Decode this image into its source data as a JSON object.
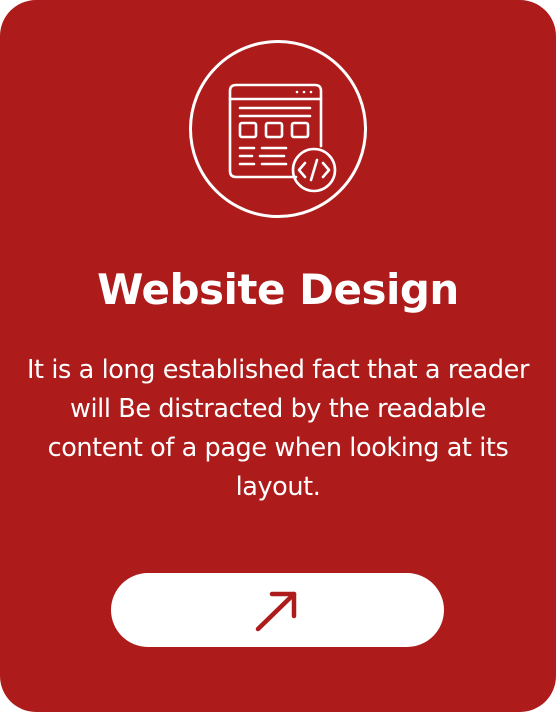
{
  "card": {
    "title": "Website Design",
    "description": "It is a long established fact that a reader will Be distracted by the readable content of a page when looking at its layout.",
    "icon": "web-code-icon",
    "cta_icon": "arrow-up-right-icon"
  },
  "colors": {
    "card_background": "#ad1b1b",
    "foreground": "#ffffff",
    "button_background": "#ffffff",
    "arrow": "#ad1b1b"
  }
}
